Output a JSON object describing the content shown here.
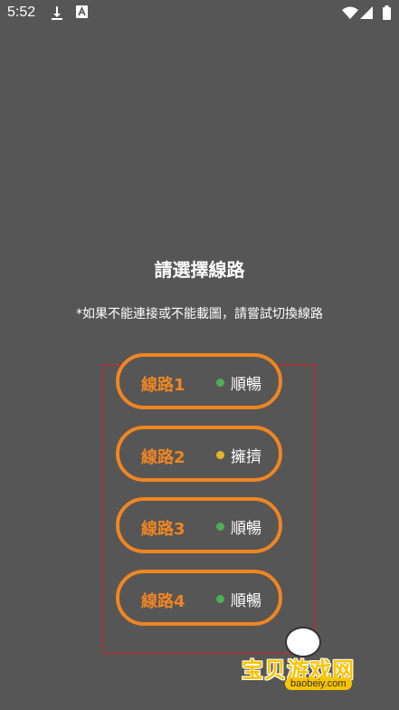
{
  "status_bar": {
    "time": "5:52",
    "icons": [
      "download-icon",
      "a-notification-icon",
      "wifi-icon",
      "signal-icon",
      "battery-icon"
    ]
  },
  "dialog": {
    "title": "請選擇線路",
    "subtitle": "*如果不能連接或不能載圖，請嘗試切換線路"
  },
  "lines": [
    {
      "label": "線路1",
      "status": "順暢",
      "status_color": "#4caf50"
    },
    {
      "label": "線路2",
      "status": "擁擠",
      "status_color": "#e6b422"
    },
    {
      "label": "線路3",
      "status": "順暢",
      "status_color": "#4caf50"
    },
    {
      "label": "線路4",
      "status": "順暢",
      "status_color": "#4caf50"
    }
  ],
  "colors": {
    "background": "#565656",
    "accent": "#f08522",
    "highlight_border": "#d42020"
  },
  "watermark": {
    "cn": "宝贝游戏网",
    "url": "baobeiy.com"
  }
}
